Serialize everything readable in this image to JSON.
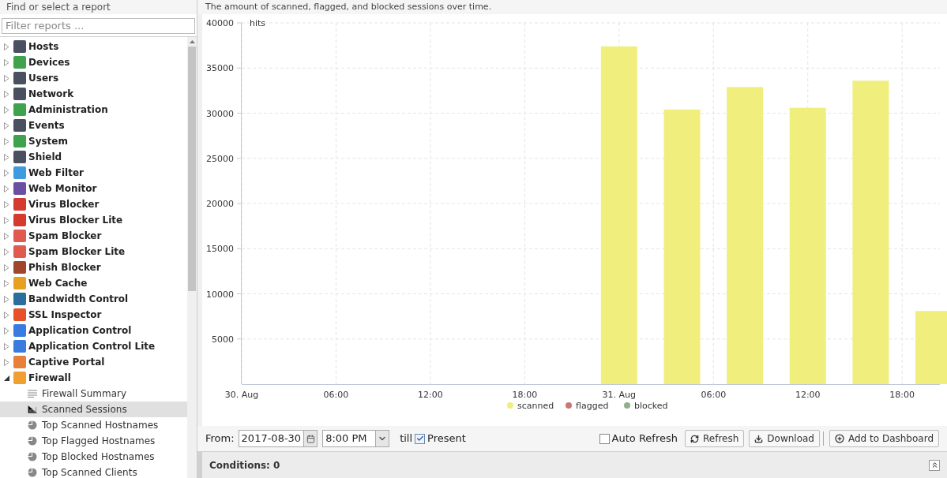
{
  "sidebar": {
    "title": "Find or select a report",
    "filter": {
      "placeholder": "Filter reports ..."
    },
    "items": [
      {
        "label": "Hosts",
        "color": "#4a5060",
        "expanded": false
      },
      {
        "label": "Devices",
        "color": "#3fa34d",
        "expanded": false
      },
      {
        "label": "Users",
        "color": "#4a5060",
        "expanded": false
      },
      {
        "label": "Network",
        "color": "#4a5060",
        "expanded": false
      },
      {
        "label": "Administration",
        "color": "#3fa34d",
        "expanded": false
      },
      {
        "label": "Events",
        "color": "#4a5060",
        "expanded": false
      },
      {
        "label": "System",
        "color": "#3fa34d",
        "expanded": false
      },
      {
        "label": "Shield",
        "color": "#4a5060",
        "expanded": false
      },
      {
        "label": "Web Filter",
        "color": "#3d9be0",
        "expanded": false
      },
      {
        "label": "Web Monitor",
        "color": "#6b4fa0",
        "expanded": false
      },
      {
        "label": "Virus Blocker",
        "color": "#d63a2f",
        "expanded": false
      },
      {
        "label": "Virus Blocker Lite",
        "color": "#d63a2f",
        "expanded": false
      },
      {
        "label": "Spam Blocker",
        "color": "#e05a4f",
        "expanded": false
      },
      {
        "label": "Spam Blocker Lite",
        "color": "#e05a4f",
        "expanded": false
      },
      {
        "label": "Phish Blocker",
        "color": "#a0462a",
        "expanded": false
      },
      {
        "label": "Web Cache",
        "color": "#e8a020",
        "expanded": false
      },
      {
        "label": "Bandwidth Control",
        "color": "#2a6e9e",
        "expanded": false
      },
      {
        "label": "SSL Inspector",
        "color": "#e8502a",
        "expanded": false
      },
      {
        "label": "Application Control",
        "color": "#3a7be0",
        "expanded": false
      },
      {
        "label": "Application Control Lite",
        "color": "#3a7be0",
        "expanded": false
      },
      {
        "label": "Captive Portal",
        "color": "#e8803a",
        "expanded": false
      },
      {
        "label": "Firewall",
        "color": "#f0a030",
        "expanded": true,
        "children": [
          {
            "label": "Firewall Summary",
            "kind": "text",
            "selected": false
          },
          {
            "label": "Scanned Sessions",
            "kind": "bar",
            "selected": true
          },
          {
            "label": "Top Scanned Hostnames",
            "kind": "pie",
            "selected": false
          },
          {
            "label": "Top Flagged Hostnames",
            "kind": "pie",
            "selected": false
          },
          {
            "label": "Top Blocked Hostnames",
            "kind": "pie",
            "selected": false
          },
          {
            "label": "Top Scanned Clients",
            "kind": "pie",
            "selected": false
          }
        ]
      }
    ]
  },
  "report": {
    "description": "The amount of scanned, flagged, and blocked sessions over time.",
    "chart_data": {
      "type": "bar",
      "ylabel": "hits",
      "x": [
        "2017-08-31T00:00",
        "2017-08-31T04:00",
        "2017-08-31T08:00",
        "2017-08-31T12:00",
        "2017-08-31T16:00",
        "2017-08-31T20:00"
      ],
      "series": [
        {
          "name": "scanned",
          "color": "#f0ef7e",
          "values": [
            37400,
            30400,
            32900,
            30600,
            33600,
            8100
          ]
        },
        {
          "name": "flagged",
          "color": "#c87777",
          "values": [
            0,
            0,
            0,
            0,
            0,
            0
          ]
        },
        {
          "name": "blocked",
          "color": "#8fb08a",
          "values": [
            0,
            0,
            0,
            0,
            0,
            0
          ]
        }
      ],
      "xlim": [
        "2017-08-30T00:00",
        "2017-08-31T20:24"
      ],
      "ylim": [
        0,
        40000
      ],
      "grid": true,
      "xticks": [
        {
          "value": "2017-08-30T00:00",
          "label": "30. Aug"
        },
        {
          "value": "2017-08-30T06:00",
          "label": "06:00"
        },
        {
          "value": "2017-08-30T12:00",
          "label": "12:00"
        },
        {
          "value": "2017-08-30T18:00",
          "label": "18:00"
        },
        {
          "value": "2017-08-31T00:00",
          "label": "31. Aug"
        },
        {
          "value": "2017-08-31T06:00",
          "label": "06:00"
        },
        {
          "value": "2017-08-31T12:00",
          "label": "12:00"
        },
        {
          "value": "2017-08-31T18:00",
          "label": "18:00"
        }
      ],
      "yticks": [
        5000,
        10000,
        15000,
        20000,
        25000,
        30000,
        35000,
        40000
      ]
    }
  },
  "toolbar": {
    "from_label": "From:",
    "date": "2017-08-30",
    "time": "8:00 PM",
    "till_label": "till",
    "present": {
      "label": "Present",
      "checked": true
    },
    "auto_refresh": {
      "label": "Auto Refresh",
      "checked": false
    },
    "buttons": [
      {
        "kind": "refresh",
        "label": "Refresh"
      },
      {
        "kind": "download",
        "label": "Download"
      },
      {
        "kind": "add",
        "label": "Add to Dashboard"
      }
    ]
  },
  "conditions": {
    "label": "Conditions: 0"
  }
}
